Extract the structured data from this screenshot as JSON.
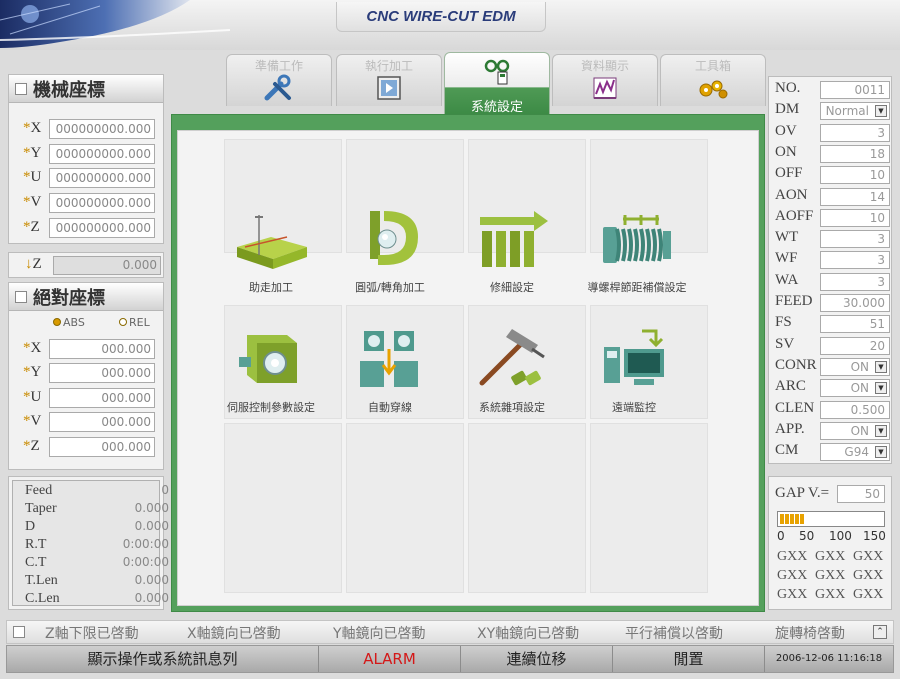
{
  "header": {
    "title": "CNC WIRE-CUT EDM"
  },
  "machine_coords": {
    "title": "機械座標",
    "axes": [
      {
        "label": "X",
        "value": "000000000.000"
      },
      {
        "label": "Y",
        "value": "000000000.000"
      },
      {
        "label": "U",
        "value": "000000000.000"
      },
      {
        "label": "V",
        "value": "000000000.000"
      },
      {
        "label": "Z",
        "value": "000000000.000"
      }
    ],
    "zdown": {
      "label": "Z",
      "value": "0.000"
    }
  },
  "absolute_coords": {
    "title": "絕對座標",
    "abs_label": "ABS",
    "rel_label": "REL",
    "axes": [
      {
        "label": "X",
        "value": "000.000"
      },
      {
        "label": "Y",
        "value": "000.000"
      },
      {
        "label": "U",
        "value": "000.000"
      },
      {
        "label": "V",
        "value": "000.000"
      },
      {
        "label": "Z",
        "value": "000.000"
      }
    ]
  },
  "status_info": [
    {
      "label": "Feed",
      "value": "0"
    },
    {
      "label": "Taper",
      "value": "0.000"
    },
    {
      "label": "D",
      "value": "0.000"
    },
    {
      "label": "R.T",
      "value": "0:00:00"
    },
    {
      "label": "C.T",
      "value": "0:00:00"
    },
    {
      "label": "T.Len",
      "value": "0.000"
    },
    {
      "label": "C.Len",
      "value": "0.000"
    }
  ],
  "tabs": [
    {
      "label": "準備工作",
      "icon": "wrench-icon"
    },
    {
      "label": "執行加工",
      "icon": "play-icon"
    },
    {
      "label": "系統設定",
      "icon": "system-settings-icon"
    },
    {
      "label": "資料顯示",
      "icon": "chart-icon"
    },
    {
      "label": "工具箱",
      "icon": "toolbox-icon"
    }
  ],
  "functions": [
    {
      "label": "助走加工",
      "icon": "wire-plate-icon"
    },
    {
      "label": "圓弧/轉角加工",
      "icon": "arc-corner-icon"
    },
    {
      "label": "修細設定",
      "icon": "trim-bars-icon"
    },
    {
      "label": "導螺桿節距補償設定",
      "icon": "leadscrew-icon"
    },
    {
      "label": "伺服控制參數設定",
      "icon": "servo-icon"
    },
    {
      "label": "自動穿線",
      "icon": "auto-thread-icon"
    },
    {
      "label": "系統雜項設定",
      "icon": "hammer-icon"
    },
    {
      "label": "遠端監控",
      "icon": "remote-monitor-icon"
    }
  ],
  "params": [
    {
      "label": "NO.",
      "value": "0011"
    },
    {
      "label": "DM",
      "value": "Normal",
      "dropdown": true
    },
    {
      "label": "OV",
      "value": "3"
    },
    {
      "label": "ON",
      "value": "18"
    },
    {
      "label": "OFF",
      "value": "10"
    },
    {
      "label": "AON",
      "value": "14"
    },
    {
      "label": "AOFF",
      "value": "10"
    },
    {
      "label": "WT",
      "value": "3"
    },
    {
      "label": "WF",
      "value": "3"
    },
    {
      "label": "WA",
      "value": "3"
    },
    {
      "label": "FEED",
      "value": "30.000"
    },
    {
      "label": "FS",
      "value": "51"
    },
    {
      "label": "SV",
      "value": "20"
    },
    {
      "label": "CONR",
      "value": "ON",
      "dropdown": true
    },
    {
      "label": "ARC",
      "value": "ON",
      "dropdown": true
    },
    {
      "label": "CLEN",
      "value": "0.500"
    },
    {
      "label": "APP.",
      "value": "ON",
      "dropdown": true
    },
    {
      "label": "CM",
      "value": "G94",
      "dropdown": true
    }
  ],
  "gap": {
    "label": "GAP V.=",
    "value": "50",
    "level": 0.24,
    "scale": [
      "0",
      "50",
      "100",
      "150"
    ],
    "gxx": [
      "GXX",
      "GXX",
      "GXX",
      "GXX",
      "GXX",
      "GXX",
      "GXX",
      "GXX",
      "GXX"
    ]
  },
  "status_messages": [
    "Z軸下限已啓動",
    "X軸鏡向已啓動",
    "Y軸鏡向已啓動",
    "XY軸鏡向已啓動",
    "平行補償以啓動",
    "旋轉椅啓動"
  ],
  "bottom": {
    "message": "顯示操作或系統訊息列",
    "alarm": "ALARM",
    "mode": "連續位移",
    "state": "閒置",
    "datetime": "2006-12-06   11:16:18"
  },
  "colors": {
    "accent_green": "#54a05c",
    "alarm_red": "#d41818",
    "coord_star": "#c98b00",
    "gap_bar": "#e8a200"
  }
}
